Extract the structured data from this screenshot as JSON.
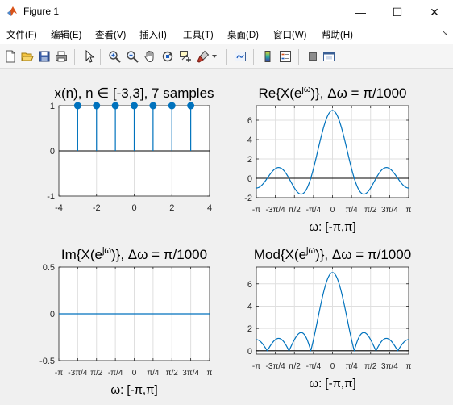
{
  "window": {
    "title": "Figure 1"
  },
  "window_controls": {
    "minimize": "—",
    "maximize": "☐",
    "close": "✕"
  },
  "menu": {
    "items": [
      "文件(F)",
      "编辑(E)",
      "查看(V)",
      "插入(I)",
      "工具(T)",
      "桌面(D)",
      "窗口(W)",
      "帮助(H)"
    ],
    "overflow": "↘"
  },
  "toolbar": {
    "icons": [
      "new-figure-icon",
      "open-file-icon",
      "save-icon",
      "print-icon",
      "pointer-icon",
      "zoom-in-icon",
      "zoom-out-icon",
      "pan-hand-icon",
      "rotate-3d-icon",
      "data-cursor-icon",
      "brush-icon",
      "link-plot-icon",
      "colorbar-icon",
      "legend-icon",
      "hide-plot-tools-icon",
      "show-plot-tools-icon"
    ]
  },
  "colors": {
    "series": "#0072bd",
    "axis_line": "#262626",
    "grid": "#dfdfdf",
    "plot_bg": "#ffffff",
    "figure_bg": "#f0f0f0"
  },
  "omega_ticks": [
    "-π",
    "-3π/4",
    "π/2",
    "-π/4",
    "0",
    "π/4",
    "π/2",
    "3π/4",
    "π"
  ],
  "chart_data": [
    {
      "type": "stem",
      "title": "x(n), n ∈ [-3,3], 7 samples",
      "x": [
        -3,
        -2,
        -1,
        0,
        1,
        2,
        3
      ],
      "y": [
        1,
        1,
        1,
        1,
        1,
        1,
        1
      ],
      "xlim": [
        -4,
        4
      ],
      "ylim": [
        -1,
        1
      ],
      "xticks": [
        -4,
        -2,
        0,
        2,
        4
      ],
      "yticks": [
        -1,
        0,
        1
      ],
      "xlabel": "",
      "grid": true
    },
    {
      "type": "line",
      "title": "Re{X(e^jω)}, Δω = π/1000",
      "function": "sin(7ω/2)/sin(ω/2)",
      "xlim": [
        -3.1416,
        3.1416
      ],
      "ylim": [
        -2,
        7.5
      ],
      "yticks": [
        -2,
        0,
        2,
        4,
        6
      ],
      "xlabel": "ω: [-π,π]",
      "grid": true
    },
    {
      "type": "line",
      "title": "Im{X(e^jω)}, Δω = π/1000",
      "function": "0",
      "xlim": [
        -3.1416,
        3.1416
      ],
      "ylim": [
        -0.5,
        0.5
      ],
      "yticks": [
        -0.5,
        0,
        0.5
      ],
      "xlabel": "ω: [-π,π]",
      "grid": true
    },
    {
      "type": "line",
      "title": "Mod{X(e^jω)}, Δω = π/1000",
      "function": "|sin(7ω/2)/sin(ω/2)|",
      "xlim": [
        -3.1416,
        3.1416
      ],
      "ylim": [
        -0.3,
        7.5
      ],
      "yticks": [
        0,
        2,
        4,
        6
      ],
      "xlabel": "ω: [-π,π]",
      "grid": true
    }
  ]
}
